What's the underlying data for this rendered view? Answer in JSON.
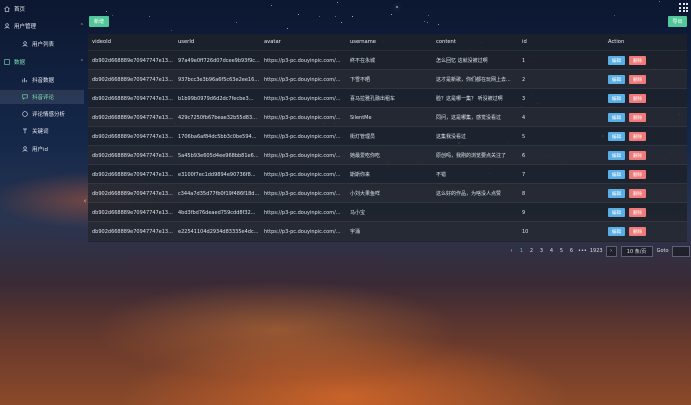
{
  "sidebar": {
    "items": [
      {
        "label": "首页",
        "icon": "home-icon"
      },
      {
        "label": "用户管理",
        "icon": "user-icon"
      },
      {
        "label": "用户列表",
        "icon": "user-list-icon"
      },
      {
        "label": "数据",
        "icon": "data-icon"
      },
      {
        "label": "抖音数据",
        "icon": "douyin-data-icon"
      },
      {
        "label": "抖音评论",
        "icon": "comment-icon"
      },
      {
        "label": "评论情感分析",
        "icon": "sentiment-icon"
      },
      {
        "label": "关键词",
        "icon": "keyword-icon"
      },
      {
        "label": "用户id",
        "icon": "user-id-icon"
      }
    ]
  },
  "toolbar": {
    "new_label": "新增",
    "export_label": "导出"
  },
  "table": {
    "headers": [
      "videoId",
      "userId",
      "avatar",
      "username",
      "content",
      "id",
      "Action"
    ],
    "edit_label": "编辑",
    "delete_label": "删除",
    "rows": [
      {
        "videoId": "db902d668889e70947747e13...",
        "userId": "97a49e0ff726d07dcee9b93f9c...",
        "avatar": "https://p3-pc.douyinpic.com/...",
        "username": "终不在永城",
        "content": "怎么回忆 这就没被过啊",
        "id": "1"
      },
      {
        "videoId": "db902d668889e70947747e13...",
        "userId": "937bcc3e3b96a6f5c63e2ee16...",
        "avatar": "https://p3-pc.douyinpic.com/...",
        "username": "下雪不晒",
        "content": "这才是新歌，你们都在玩网上去...",
        "id": "2"
      },
      {
        "videoId": "db902d668889e70947747e13...",
        "userId": "b1b99b0979d6d2dc7fecbe3...",
        "avatar": "https://p3-pc.douyinpic.com/...",
        "username": "喜马拉雅孔融出租车",
        "content": "脸？这是哪一集？ 听没被过啊",
        "id": "3"
      },
      {
        "videoId": "db902d668889e70947747e13...",
        "userId": "429c7250fb67beae32b55d83...",
        "avatar": "https://p3-pc.douyinpic.com/...",
        "username": "SilentMe",
        "content": "同问，这是哪集，感觉没看过",
        "id": "4"
      },
      {
        "videoId": "db902d668889e70947747e13...",
        "userId": "1706ba6af84dc5bb3c0be594...",
        "avatar": "https://p3-pc.douyinpic.com/...",
        "username": "街灯管理员",
        "content": "这集我没看过",
        "id": "5"
      },
      {
        "videoId": "db902d668889e70947747e13...",
        "userId": "5a45b93e605d4ee968bb81e6...",
        "avatar": "https://p3-pc.douyinpic.com/...",
        "username": "她最爱吃你吃",
        "content": "原创吗，我刚的浏览要点关注了",
        "id": "6"
      },
      {
        "videoId": "db902d668889e70947747e13...",
        "userId": "e3100f7ec1dd9894e90736f8...",
        "avatar": "https://p3-pc.douyinpic.com/...",
        "username": "斯斯你来",
        "content": "不错",
        "id": "7"
      },
      {
        "videoId": "db902d668889e70947747e13...",
        "userId": "c344a7d35d77fb0f19f486f18d...",
        "avatar": "https://p3-pc.douyinpic.com/...",
        "username": "小刘大果鱼咩",
        "content": "这么好的作品，为啥没人点赞",
        "id": "8"
      },
      {
        "videoId": "db902d668889e70947747e13...",
        "userId": "4bd3fbd76deaed759cdd8f32...",
        "avatar": "https://p3-pc.douyinpic.com/...",
        "username": "马小宝",
        "content": "",
        "id": "9"
      },
      {
        "videoId": "db902d668889e70947747e13...",
        "userId": "e22541104d2934d83335e4dc...",
        "avatar": "https://p3-pc.douyinpic.com/...",
        "username": "宇涌",
        "content": "",
        "id": "10"
      }
    ]
  },
  "pagination": {
    "pages": [
      "1",
      "2",
      "3",
      "4",
      "5",
      "6",
      "•••",
      "1923"
    ],
    "active_page": "1",
    "prev_icon": "chevron-left-icon",
    "next_icon": "chevron-right-icon",
    "page_size_label": "10 条/页",
    "goto_label": "Goto"
  },
  "colors": {
    "accent": "#51c79a",
    "edit": "#5aaee6",
    "delete": "#f07a7a",
    "table_bg": "#1e222a"
  }
}
